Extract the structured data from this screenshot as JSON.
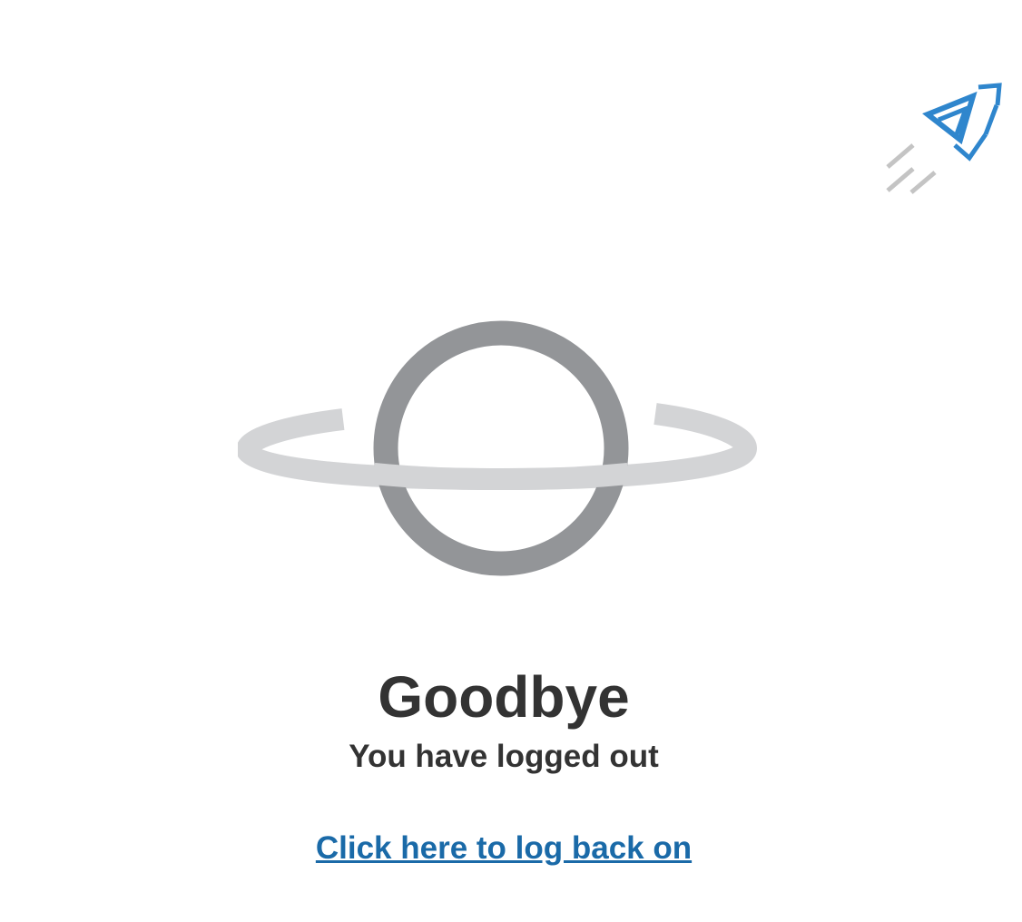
{
  "logout": {
    "title": "Goodbye",
    "subtitle": "You have logged out",
    "relogin_link": "Click here to log back on"
  },
  "icons": {
    "brand": "rocket-icon",
    "hero": "planet-icon"
  },
  "colors": {
    "link": "#1a6aa8",
    "rocket_blue": "#2f86cd",
    "rocket_trail": "#c4c4c4",
    "planet_body": "#939598",
    "planet_ring": "#d3d4d6",
    "text": "#333333"
  }
}
